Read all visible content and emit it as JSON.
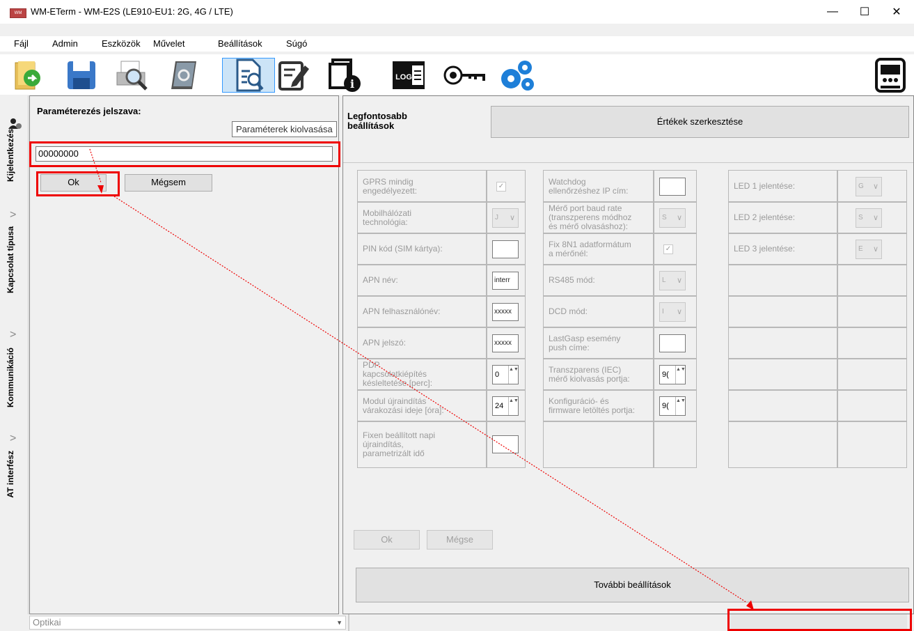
{
  "window": {
    "title": "WM-ETerm - WM-E2S (LE910-EU1: 2G, 4G / LTE)",
    "app_icon_text": "WM"
  },
  "menu": [
    "Fájl",
    "Admin",
    "Eszközök",
    "Művelet",
    "Beállítások",
    "Súgó"
  ],
  "toolbar": {
    "icons": [
      "open-folder-icon",
      "save-icon",
      "print-preview-icon",
      "manual-icon",
      "parameter-read-icon",
      "parameter-edit-icon",
      "info-icon",
      "log-icon",
      "key-rotate-icon",
      "gears-icon",
      "meter-icon"
    ],
    "tooltip": "Paraméterek kiolvasása",
    "log_text": "LOG"
  },
  "sidebar": {
    "tabs": [
      "Kijelentkezés",
      "Kapcsolat típusa",
      "Kommunikáció",
      "AT interfész"
    ]
  },
  "login": {
    "password_label": "Paraméterezés jelszava:",
    "password_value": "00000000",
    "ok_label": "Ok",
    "cancel_label": "Mégsem"
  },
  "settings": {
    "header": "Legfontosabb\nbeállítások",
    "edit_button": "Értékek szerkesztése",
    "col1": [
      {
        "label": "GPRS mindig\nengedélyezett:",
        "control": "check",
        "value": "✓"
      },
      {
        "label": "Mobilhálózati\ntechnológia:",
        "control": "dd",
        "value": "J"
      },
      {
        "label": "PIN kód (SIM kártya):",
        "control": "input",
        "value": ""
      },
      {
        "label": "APN név:",
        "control": "input",
        "value": "interr"
      },
      {
        "label": "APN felhasználónév:",
        "control": "input",
        "value": "xxxxx"
      },
      {
        "label": "APN jelszó:",
        "control": "input",
        "value": "xxxxx"
      },
      {
        "label": "PDP\nkapcsolatkiépítés\nkésleltetése [perc]:",
        "control": "spin",
        "value": "0"
      },
      {
        "label": "Modul újraindítás\nvárakozási ideje [óra]:",
        "control": "spin",
        "value": "24"
      },
      {
        "label": "Fixen beállított napi\nújraindítás,\nparametrizált idő",
        "control": "input",
        "value": ""
      }
    ],
    "col2": [
      {
        "label": "Watchdog\nellenőrzéshez IP cím:",
        "control": "input",
        "value": ""
      },
      {
        "label": "Mérő port baud rate\n(transzperens módhoz\nés mérő olvasáshoz):",
        "control": "dd",
        "value": "S"
      },
      {
        "label": "Fix 8N1 adatformátum\na mérőnél:",
        "control": "check",
        "value": "✓"
      },
      {
        "label": "RS485 mód:",
        "control": "dd",
        "value": "L"
      },
      {
        "label": "DCD mód:",
        "control": "dd",
        "value": "I"
      },
      {
        "label": "LastGasp esemény\npush címe:",
        "control": "input",
        "value": ""
      },
      {
        "label": "Transzparens (IEC)\nmérő kiolvasás portja:",
        "control": "spin",
        "value": "9("
      },
      {
        "label": "Konfiguráció- és\nfirmware letöltés portja:",
        "control": "spin",
        "value": "9("
      },
      {
        "label": "",
        "control": "none",
        "value": ""
      }
    ],
    "col3": [
      {
        "label": "LED 1 jelentése:",
        "control": "dd",
        "value": "G"
      },
      {
        "label": "LED 2 jelentése:",
        "control": "dd",
        "value": "S"
      },
      {
        "label": "LED 3 jelentése:",
        "control": "dd",
        "value": "E"
      }
    ],
    "ok_label": "Ok",
    "cancel_label": "Mégse",
    "more_button": "További beállítások"
  },
  "status": {
    "connection": "Optikai"
  }
}
